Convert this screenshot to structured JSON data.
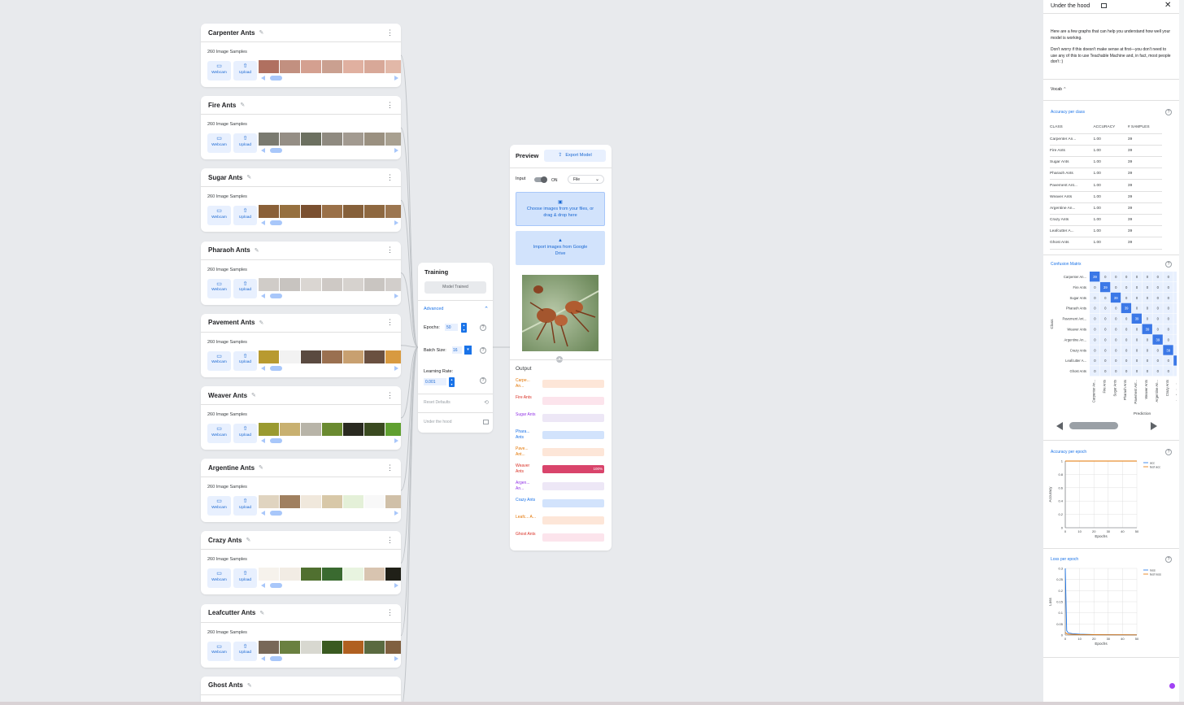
{
  "classes": [
    {
      "name": "Carpenter Ants",
      "samples": "260 Image Samples",
      "thumb_colors": [
        "#b07060",
        "#c29080",
        "#d4a090",
        "#caa090",
        "#e0b0a0",
        "#d8a898",
        "#e2b8a8"
      ]
    },
    {
      "name": "Fire Ants",
      "samples": "260 Image Samples",
      "thumb_colors": [
        "#7a7a70",
        "#958e85",
        "#6c7060",
        "#8f8a80",
        "#a29a90",
        "#9a9080",
        "#a8a090"
      ]
    },
    {
      "name": "Sugar Ants",
      "samples": "260 Image Samples",
      "thumb_colors": [
        "#8a6038",
        "#96703f",
        "#7a5030",
        "#9a7048",
        "#86603a",
        "#8e6840",
        "#9c7650"
      ]
    },
    {
      "name": "Pharaoh Ants",
      "samples": "260 Image Samples",
      "thumb_colors": [
        "#d0ccc8",
        "#c8c4c0",
        "#dad6d2",
        "#cec9c5",
        "#d6d2ce",
        "#c9c5c1",
        "#d2cecb"
      ]
    },
    {
      "name": "Pavement Ants",
      "samples": "260 Image Samples",
      "thumb_colors": [
        "#b89a30",
        "#f2f2f2",
        "#5a4a40",
        "#9a7050",
        "#c8a070",
        "#6a5040",
        "#d89a40"
      ]
    },
    {
      "name": "Weaver Ants",
      "samples": "260 Image Samples",
      "thumb_colors": [
        "#9a9a30",
        "#c8b070",
        "#b8b4a8",
        "#6a8a30",
        "#2a2a20",
        "#3a4a20",
        "#60a030"
      ]
    },
    {
      "name": "Argentine Ants",
      "samples": "260 Image Samples",
      "thumb_colors": [
        "#e0d4c0",
        "#a08060",
        "#f0e8dc",
        "#d8c8a8",
        "#e4f0d8",
        "#f8f8f8",
        "#d0c0a8"
      ]
    },
    {
      "name": "Crazy Ants",
      "samples": "260 Image Samples",
      "thumb_colors": [
        "#f6f2ec",
        "#f2ece4",
        "#507030",
        "#3a6a30",
        "#e8f4e0",
        "#d8c4b0",
        "#202018"
      ]
    },
    {
      "name": "Leafcutter Ants",
      "samples": "260 Image Samples",
      "thumb_colors": [
        "#786858",
        "#6a8040",
        "#d8d8d0",
        "#3a5a20",
        "#b06020",
        "#5a6a40",
        "#806040"
      ]
    },
    {
      "name": "Ghost Ants",
      "samples": "",
      "thumb_colors": []
    }
  ],
  "card_buttons": {
    "webcam": "Webcam",
    "upload": "Upload"
  },
  "training": {
    "title": "Training",
    "trained_button": "Model Trained",
    "advanced": "Advanced",
    "epochs_label": "Epochs:",
    "epochs_value": "50",
    "batch_label": "Batch Size:",
    "batch_value": "16",
    "lr_label": "Learning Rate:",
    "lr_value": "0.001",
    "reset": "Reset Defaults",
    "under_hood": "Under the hood"
  },
  "preview": {
    "title": "Preview",
    "export": "Export Model",
    "input_label": "Input",
    "toggle": "ON",
    "source": "File",
    "choose_files": "Choose images from your files, or drag & drop here",
    "import_drive": "Import images from Google Drive",
    "output_label": "Output",
    "outputs": [
      {
        "label": "Carpe... An...",
        "color": "#e37400",
        "bg": "#fde6d8",
        "fill": 0
      },
      {
        "label": "Fire Ants",
        "color": "#d93025",
        "bg": "#fce4ec",
        "fill": 0
      },
      {
        "label": "Sugar Ants",
        "color": "#9334e6",
        "bg": "#ede7f6",
        "fill": 0
      },
      {
        "label": "Phara... Ants",
        "color": "#1a73e8",
        "bg": "#d2e3fc",
        "fill": 0
      },
      {
        "label": "Pave... Ant...",
        "color": "#e37400",
        "bg": "#fde6d8",
        "fill": 0
      },
      {
        "label": "Weaver Ants",
        "color": "#d93025",
        "bg": "#fce4ec",
        "fill": 100,
        "fill_color": "#d9446b",
        "value": "100%"
      },
      {
        "label": "Argen... An...",
        "color": "#9334e6",
        "bg": "#ede7f6",
        "fill": 0
      },
      {
        "label": "Crazy Ants",
        "color": "#1a73e8",
        "bg": "#d2e3fc",
        "fill": 0
      },
      {
        "label": "Leafc... A...",
        "color": "#e37400",
        "bg": "#fde6d8",
        "fill": 0
      },
      {
        "label": "Ghost Ants",
        "color": "#d93025",
        "bg": "#fce4ec",
        "fill": 0
      }
    ]
  },
  "hood": {
    "title": "Under the hood",
    "intro1": "Here are a few graphs that can help you understand how well your model is working.",
    "intro2": "Don't worry if this doesn't make sense at first—you don't need to use any of this to use Teachable Machine and, in fact, most people don't :)",
    "vocab": "Vocab",
    "acc_class_title": "Accuracy per class",
    "acc_headers": [
      "CLASS",
      "ACCURACY",
      "# SAMPLES"
    ],
    "acc_rows": [
      [
        "Carpenter An...",
        "1.00",
        "39"
      ],
      [
        "Fire Ants",
        "1.00",
        "39"
      ],
      [
        "Sugar Ants",
        "1.00",
        "39"
      ],
      [
        "Pharaoh Ants",
        "1.00",
        "39"
      ],
      [
        "Pavement Ant...",
        "1.00",
        "39"
      ],
      [
        "Weaver Ants",
        "1.00",
        "39"
      ],
      [
        "Argentine An...",
        "1.00",
        "39"
      ],
      [
        "Crazy Ants",
        "1.00",
        "39"
      ],
      [
        "Leafcutter A...",
        "1.00",
        "39"
      ],
      [
        "Ghost Ants",
        "1.00",
        "39"
      ]
    ],
    "cm_title": "Confusion Matrix",
    "cm_labels": [
      "Carpenter An...",
      "Fire Ants",
      "Sugar Ants",
      "Pharaoh Ants",
      "Pavement Ant...",
      "Weaver Ants",
      "Argentine An...",
      "Crazy Ants",
      "Leafcutter A...",
      "Ghost Ants"
    ],
    "cm_diag_value": "39",
    "cm_xlabel": "Prediction",
    "cm_ylabel": "Class",
    "acc_epoch_title": "Accuracy per epoch",
    "loss_epoch_title": "Loss per epoch",
    "epochs_axis": "Epochs",
    "acc_axis": "Accuracy",
    "loss_axis": "Loss"
  },
  "chart_data": [
    {
      "type": "heatmap",
      "title": "Confusion Matrix",
      "xlabel": "Prediction",
      "ylabel": "Class",
      "rows": [
        "Carpenter An...",
        "Fire Ants",
        "Sugar Ants",
        "Pharaoh Ants",
        "Pavement Ant...",
        "Weaver Ants",
        "Argentine An...",
        "Crazy Ants",
        "Leafcutter A...",
        "Ghost Ants"
      ],
      "diagonal": 39,
      "off_diagonal": 0
    },
    {
      "type": "line",
      "title": "Accuracy per epoch",
      "xlabel": "Epochs",
      "ylabel": "Accuracy",
      "xlim": [
        0,
        50
      ],
      "ylim": [
        0,
        1
      ],
      "x_ticks": [
        0,
        10,
        20,
        30,
        40,
        50
      ],
      "y_ticks": [
        0,
        0.2,
        0.4,
        0.6,
        0.8,
        1
      ],
      "series": [
        {
          "name": "acc",
          "color": "#1a73e8",
          "x": [
            0,
            1,
            50
          ],
          "y": [
            1,
            1,
            1
          ]
        },
        {
          "name": "test acc",
          "color": "#e37400",
          "x": [
            0,
            1,
            50
          ],
          "y": [
            1,
            1,
            1
          ]
        }
      ]
    },
    {
      "type": "line",
      "title": "Loss per epoch",
      "xlabel": "Epochs",
      "ylabel": "Loss",
      "xlim": [
        0,
        50
      ],
      "ylim": [
        0,
        0.3
      ],
      "x_ticks": [
        0,
        10,
        20,
        30,
        40,
        50
      ],
      "y_ticks": [
        0,
        0.05,
        0.1,
        0.15,
        0.2,
        0.25,
        0.3
      ],
      "series": [
        {
          "name": "loss",
          "color": "#1a73e8",
          "x": [
            0,
            1,
            2,
            5,
            10,
            20,
            30,
            40,
            50
          ],
          "y": [
            0.3,
            0.02,
            0.01,
            0.006,
            0.004,
            0.002,
            0.0015,
            0.001,
            0.001
          ]
        },
        {
          "name": "test loss",
          "color": "#e37400",
          "x": [
            0,
            1,
            2,
            5,
            10,
            20,
            30,
            40,
            50
          ],
          "y": [
            0.012,
            0.006,
            0.004,
            0.003,
            0.002,
            0.0015,
            0.001,
            0.001,
            0.0008
          ]
        }
      ]
    }
  ]
}
